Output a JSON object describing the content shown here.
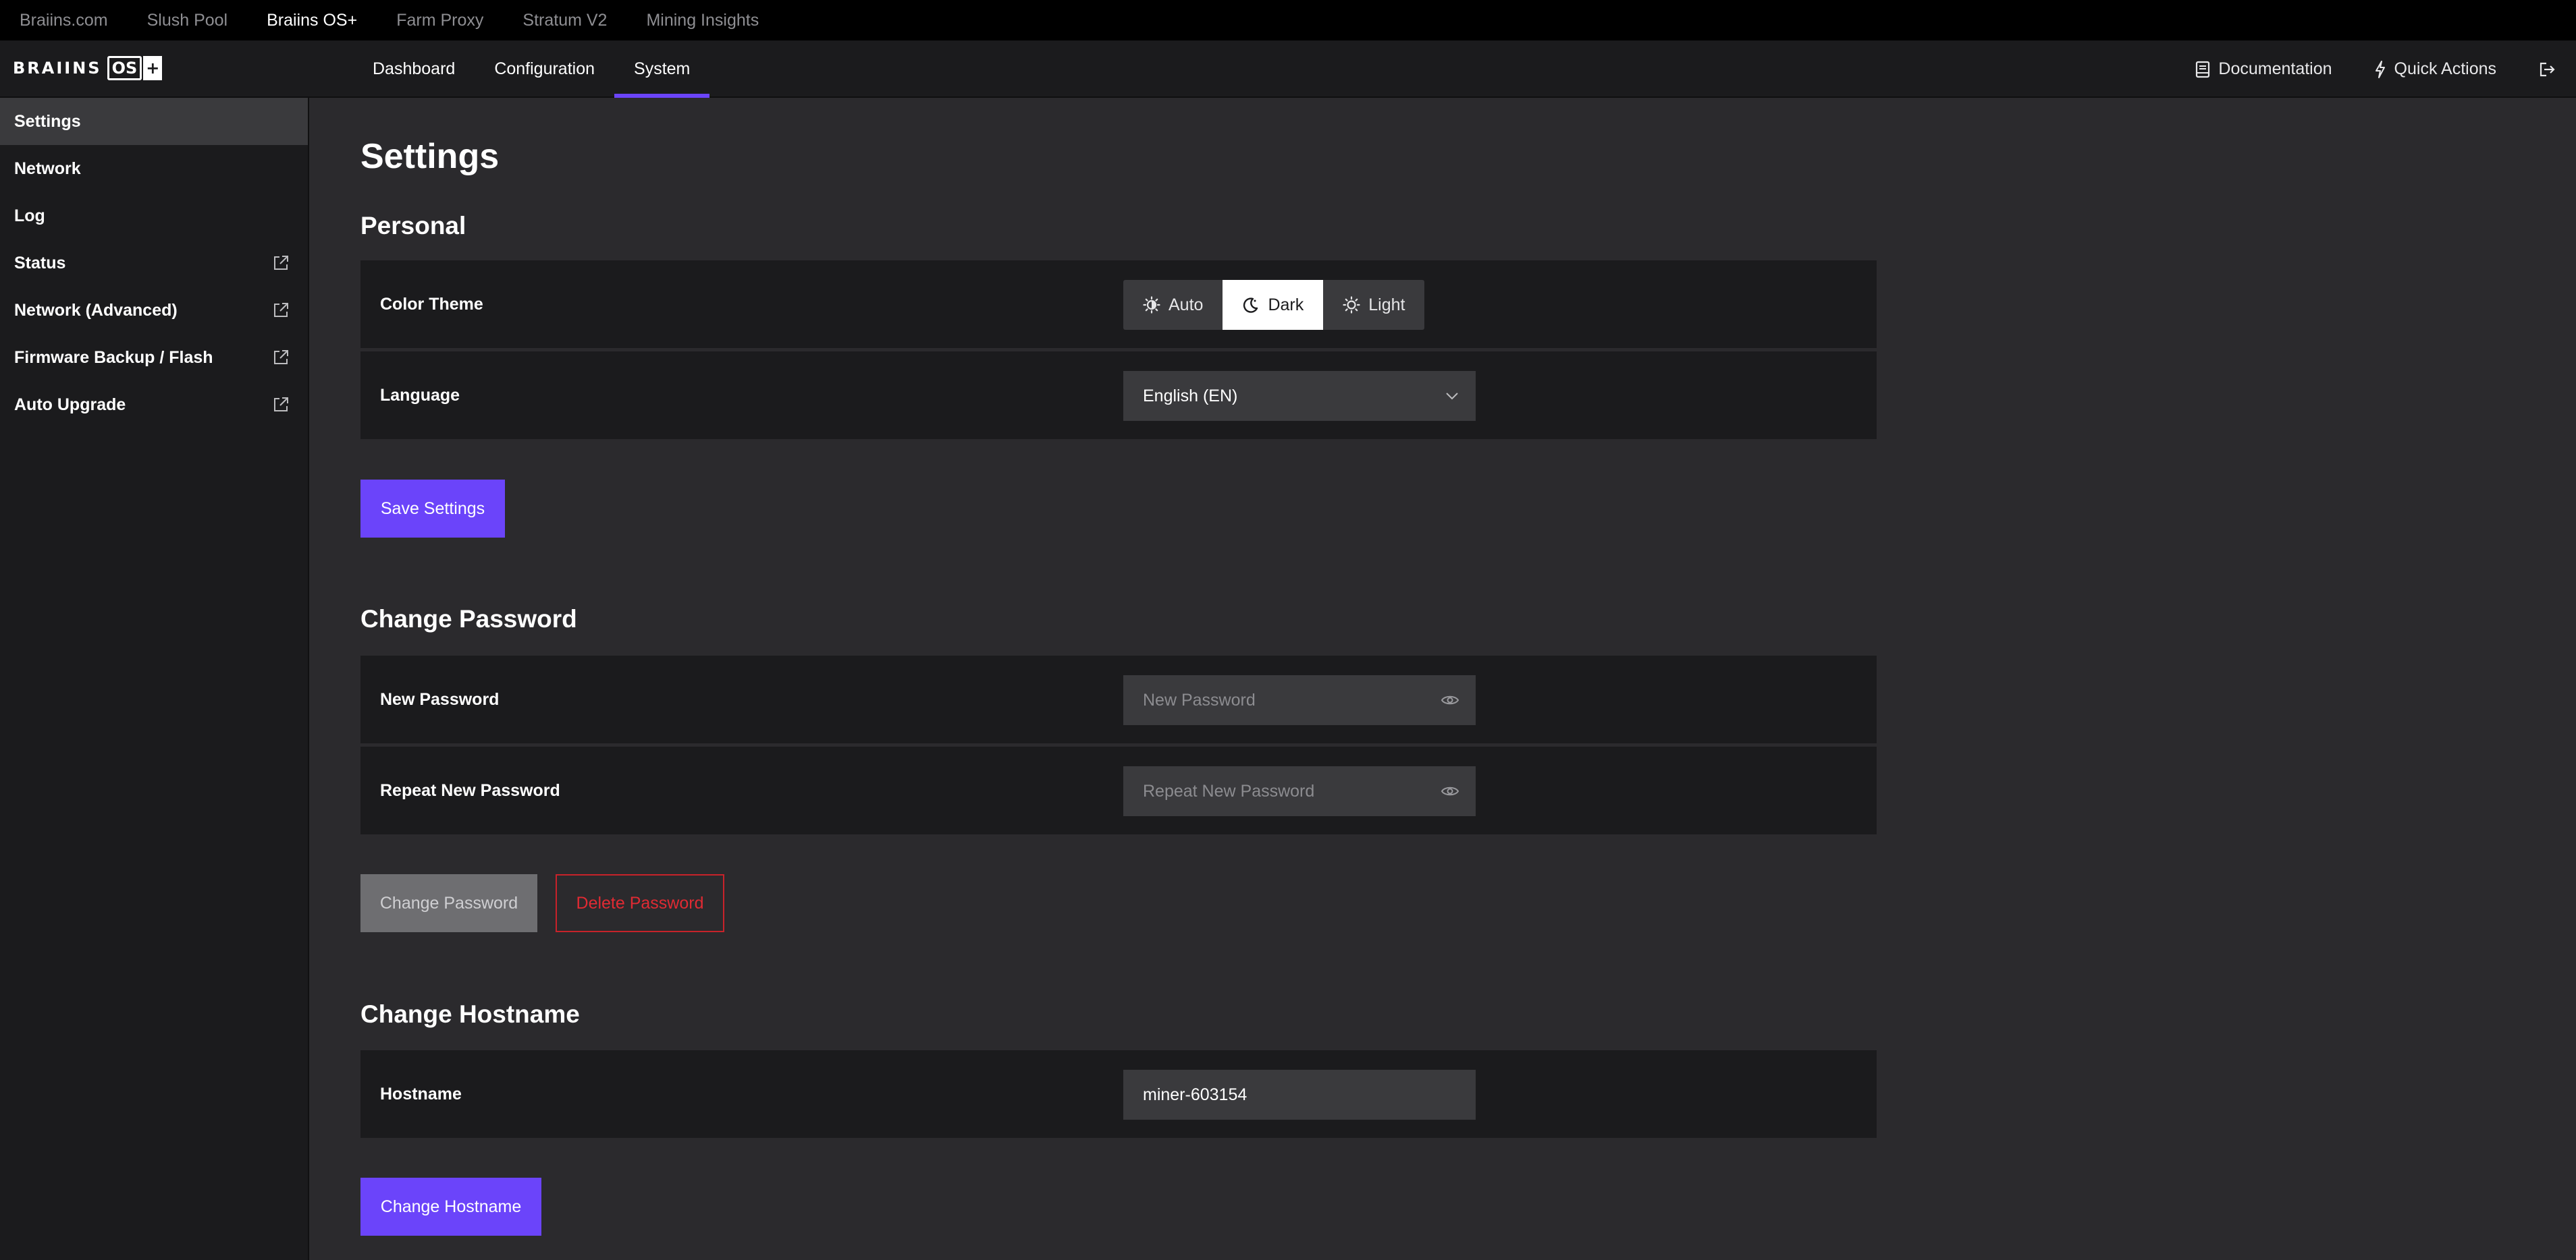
{
  "topbar": {
    "links": [
      "Braiins.com",
      "Slush Pool",
      "Braiins OS+",
      "Farm Proxy",
      "Stratum V2",
      "Mining Insights"
    ]
  },
  "header": {
    "logo_text": "BRAIINS",
    "logo_badge": "OS",
    "logo_plus": "+",
    "nav": [
      "Dashboard",
      "Configuration",
      "System"
    ],
    "documentation": "Documentation",
    "quick_actions": "Quick Actions"
  },
  "sidebar": {
    "items": [
      {
        "label": "Settings",
        "external": false
      },
      {
        "label": "Network",
        "external": false
      },
      {
        "label": "Log",
        "external": false
      },
      {
        "label": "Status",
        "external": true
      },
      {
        "label": "Network (Advanced)",
        "external": true
      },
      {
        "label": "Firmware Backup / Flash",
        "external": true
      },
      {
        "label": "Auto Upgrade",
        "external": true
      }
    ]
  },
  "page": {
    "title": "Settings",
    "personal": {
      "title": "Personal",
      "color_theme_label": "Color Theme",
      "theme_options": [
        "Auto",
        "Dark",
        "Light"
      ],
      "selected_theme": "Dark",
      "language_label": "Language",
      "language_value": "English (EN)",
      "save_button": "Save Settings"
    },
    "password": {
      "title": "Change Password",
      "new_label": "New Password",
      "new_placeholder": "New Password",
      "repeat_label": "Repeat New Password",
      "repeat_placeholder": "Repeat New Password",
      "change_button": "Change Password",
      "delete_button": "Delete Password"
    },
    "hostname": {
      "title": "Change Hostname",
      "label": "Hostname",
      "value": "miner-603154",
      "change_button": "Change Hostname"
    }
  },
  "colors": {
    "accent": "#6b44fa",
    "danger": "#e02a33",
    "background": "#2b2a2d",
    "panel": "#1b1b1d"
  }
}
